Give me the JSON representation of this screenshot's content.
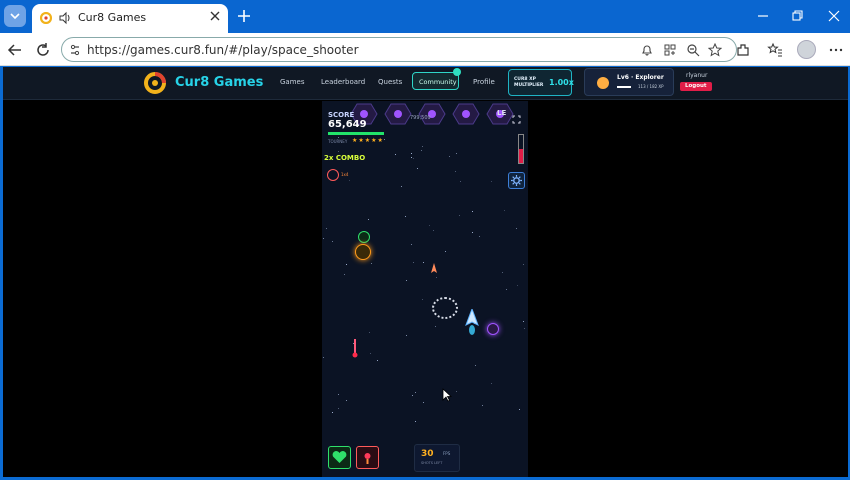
{
  "browser": {
    "tab": {
      "title": "Cur8 Games"
    },
    "address": {
      "url": "https://games.cur8.fun/#/play/space_shooter"
    }
  },
  "site": {
    "logo_text": "Cur8 Games",
    "nav": [
      {
        "label": "Games"
      },
      {
        "label": "Leaderboard"
      },
      {
        "label": "Quests"
      },
      {
        "label": "Community"
      },
      {
        "label": "Profile"
      }
    ],
    "xp_multiplier": {
      "label": "CUR8 XP MULTIPLIER",
      "value": "1.00x"
    },
    "user": {
      "level": "Lv6 · Explorer",
      "xp": "113 / 182 XP",
      "xp_progress": 0.62,
      "username": "rlyanur",
      "logout_label": "Logout"
    }
  },
  "game": {
    "score_label": "SCORE",
    "score": "65,649",
    "hiscore": "799,509",
    "health_fraction": 1.0,
    "rank_label": "TOURNEY",
    "stars": "★★★★★",
    "combo": "2x COMBO",
    "missile_count": "1x4",
    "level_label": "LE",
    "heat_fraction": 0.5,
    "ammo": {
      "value": "30",
      "unit": "FPS",
      "sub": "SHOTS LEFT"
    },
    "colors": {
      "health": "#22e36a",
      "heat": "#e11d48",
      "accent": "#27d3e8"
    }
  }
}
